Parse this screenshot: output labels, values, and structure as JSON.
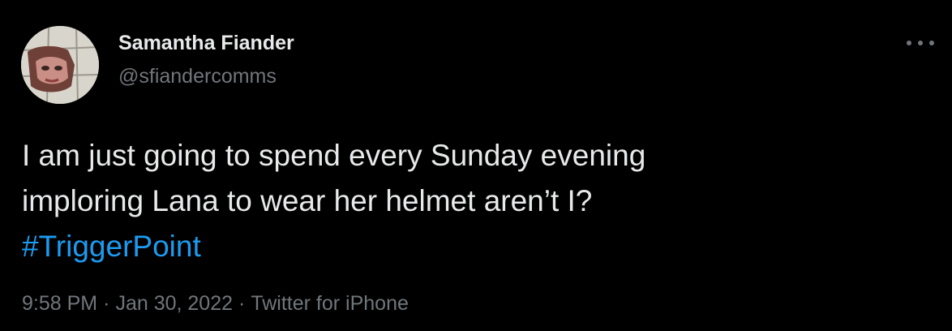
{
  "author": {
    "display_name": "Samantha Fiander",
    "handle": "@sfiandercomms"
  },
  "tweet": {
    "text_line_1": "I am just going to spend every Sunday evening",
    "text_line_2": "imploring Lana to wear her helmet aren’t I?",
    "hashtag": "#TriggerPoint"
  },
  "meta": {
    "time": "9:58 PM",
    "date": "Jan 30, 2022",
    "source": "Twitter for iPhone",
    "separator": "·"
  },
  "icons": {
    "more": "more-dots-icon",
    "avatar": "profile-photo"
  },
  "colors": {
    "background": "#000000",
    "primary_text": "#e7e9ea",
    "secondary_text": "#71767b",
    "link": "#1d9bf0"
  }
}
